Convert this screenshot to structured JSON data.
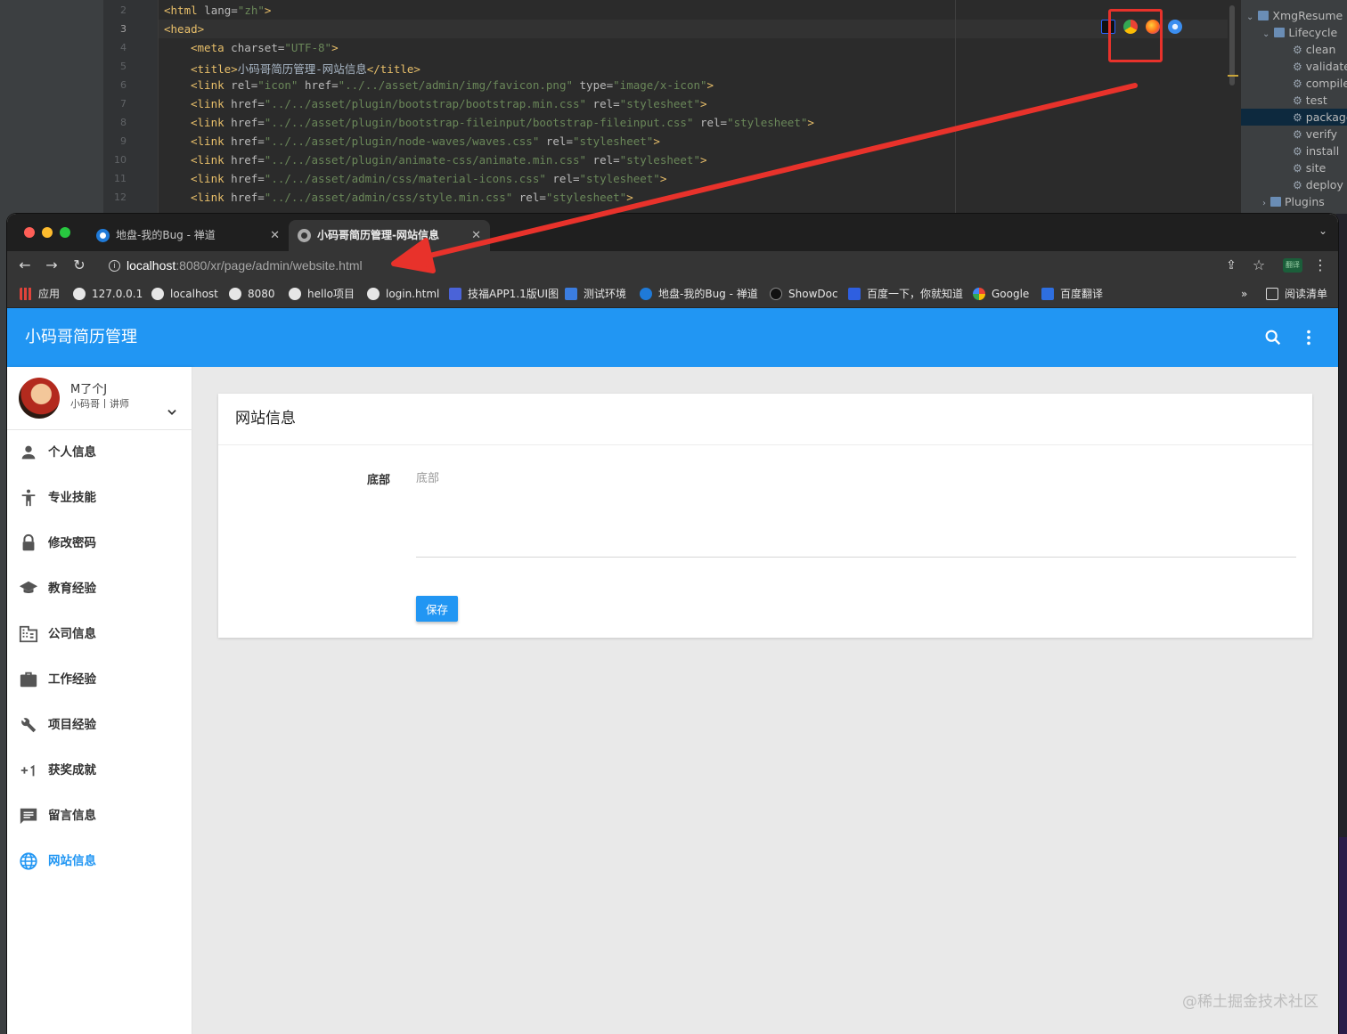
{
  "ide": {
    "line_numbers": [
      "2",
      "3",
      "4",
      "5",
      "6",
      "7",
      "8",
      "9",
      "10",
      "11",
      "12"
    ],
    "code_lines": [
      {
        "tag": "<html",
        "attr": " lang=",
        "val": "\"zh\"",
        "end": ">"
      },
      {
        "tag": "<head>",
        "attr": "",
        "val": "",
        "end": ""
      },
      {
        "tag": "<meta",
        "attr": " charset=",
        "val": "\"UTF-8\"",
        "end": ">"
      },
      {
        "tag": "<title>",
        "attr": "",
        "val": "",
        "text": "小码哥简历管理-网站信息",
        "end": "</title>"
      },
      {
        "tag": "<link",
        "attr": " rel=",
        "val": "\"icon\"",
        "attr2": " href=",
        "val2": "\"../../asset/admin/img/favicon.png\"",
        "attr3": " type=",
        "val3": "\"image/x-icon\"",
        "end": ">"
      },
      {
        "tag": "<link",
        "attr": " href=",
        "val": "\"../../asset/plugin/bootstrap/bootstrap.min.css\"",
        "attr2": " rel=",
        "val2": "\"stylesheet\"",
        "end": ">"
      },
      {
        "tag": "<link",
        "attr": " href=",
        "val": "\"../../asset/plugin/bootstrap-fileinput/bootstrap-fileinput.css\"",
        "attr2": " rel=",
        "val2": "\"stylesheet\"",
        "end": ">"
      },
      {
        "tag": "<link",
        "attr": " href=",
        "val": "\"../../asset/plugin/node-waves/waves.css\"",
        "attr2": " rel=",
        "val2": "\"stylesheet\"",
        "end": ">"
      },
      {
        "tag": "<link",
        "attr": " href=",
        "val": "\"../../asset/plugin/animate-css/animate.min.css\"",
        "attr2": " rel=",
        "val2": "\"stylesheet\"",
        "end": ">"
      },
      {
        "tag": "<link",
        "attr": " href=",
        "val": "\"../../asset/admin/css/material-icons.css\"",
        "attr2": " rel=",
        "val2": "\"stylesheet\"",
        "end": ">"
      },
      {
        "tag": "<link",
        "attr": " href=",
        "val": "\"../../asset/admin/css/style.min.css\"",
        "attr2": " rel=",
        "val2": "\"stylesheet\"",
        "end": ">"
      }
    ],
    "maven": {
      "project": "XmgResume",
      "lifecycle": "Lifecycle",
      "phases": [
        "clean",
        "validate",
        "compile",
        "test",
        "package",
        "verify",
        "install",
        "site",
        "deploy"
      ],
      "selected_phase": "package",
      "plugins": "Plugins"
    }
  },
  "browser": {
    "tabs": [
      {
        "title": "地盘-我的Bug - 禅道",
        "active": false
      },
      {
        "title": "小码哥简历管理-网站信息",
        "active": true
      }
    ],
    "url_host": "localhost",
    "url_rest": ":8080/xr/page/admin/website.html",
    "extension_label": "翻译",
    "bookmarks": [
      "应用",
      "127.0.0.1",
      "localhost",
      "8080",
      "hello项目",
      "login.html",
      "技福APP1.1版UI图",
      "测试环境",
      "地盘-我的Bug - 禅道",
      "ShowDoc",
      "百度一下，你就知道",
      "Google",
      "百度翻译"
    ],
    "more_bookmarks": "»",
    "reading_list": "阅读清单"
  },
  "app": {
    "title": "小码哥简历管理",
    "user": {
      "name": "M了个J",
      "role": "小码哥丨讲师"
    },
    "nav": [
      {
        "label": "个人信息",
        "icon": "person-icon"
      },
      {
        "label": "专业技能",
        "icon": "accessibility-icon"
      },
      {
        "label": "修改密码",
        "icon": "lock-icon"
      },
      {
        "label": "教育经验",
        "icon": "school-icon"
      },
      {
        "label": "公司信息",
        "icon": "business-icon"
      },
      {
        "label": "工作经验",
        "icon": "work-icon"
      },
      {
        "label": "项目经验",
        "icon": "build-icon"
      },
      {
        "label": "获奖成就",
        "icon": "plus-one-icon"
      },
      {
        "label": "留言信息",
        "icon": "comment-icon"
      },
      {
        "label": "网站信息",
        "icon": "globe-icon",
        "active": true
      }
    ],
    "card": {
      "title": "网站信息",
      "field_label": "底部",
      "field_placeholder": "底部",
      "save_label": "保存"
    },
    "watermark": "@稀土掘金技术社区"
  },
  "colors": {
    "primary": "#2196f3",
    "annotation_red": "#e8322b"
  }
}
